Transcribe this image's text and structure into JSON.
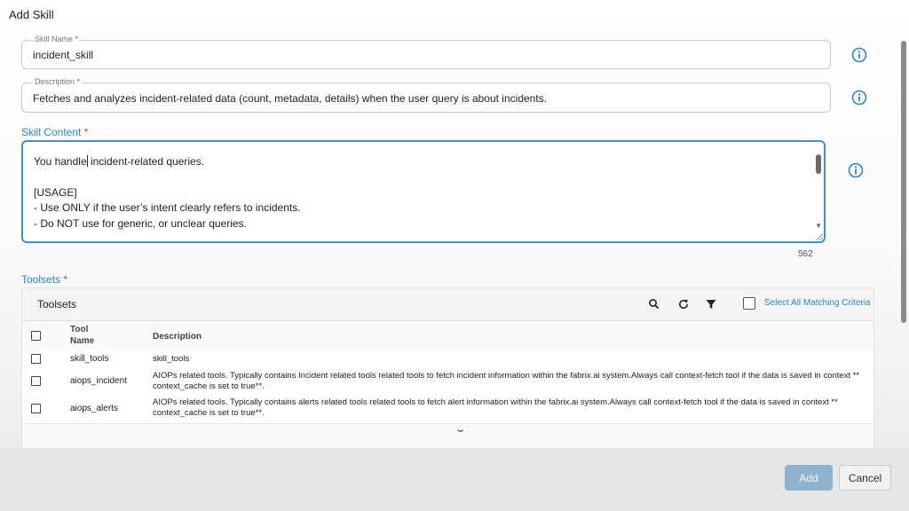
{
  "dialog": {
    "title": "Add Skill"
  },
  "skill_name": {
    "label": "Skill Name",
    "required_mark": "*",
    "value": "incident_skill"
  },
  "description": {
    "label": "Description",
    "required_mark": "*",
    "value": "Fetches and analyzes incident-related data (count, metadata, details) when the user query is about incidents."
  },
  "skill_content": {
    "label": "Skill Content",
    "required_mark": "*",
    "line1_before_caret": "You handle",
    "line1_after_caret": " incident-related queries.",
    "lines": [
      "[USAGE]",
      "- Use ONLY if the user’s intent clearly refers to incidents.",
      "- Do NOT use for generic, or unclear queries."
    ],
    "char_count": "562"
  },
  "toolsets": {
    "label": "Toolsets",
    "required_mark": "*",
    "panel_title": "Toolsets",
    "toolbar_icons": [
      "search-icon",
      "refresh-icon",
      "filter-icon"
    ],
    "select_all_label": "Select All Matching Criteria",
    "columns": {
      "tool_line1": "Tool",
      "tool_line2": "Name",
      "description": "Description"
    },
    "rows": [
      {
        "tool": "skill_tools",
        "description": "skill_tools"
      },
      {
        "tool": "aiops_incident",
        "description": "AIOPs related tools. Typically contains Incident related tools related tools to fetch incident information within the fabrix.ai system.Always call context-fetch tool if the data is saved in context ** context_cache is set to true**."
      },
      {
        "tool": "aiops_alerts",
        "description": "AIOPs related tools. Typically contains alerts related tools related tools to fetch alert information within the fabrix.ai system.Always call context-fetch tool if the data is saved in context ** context_cache is set to true**."
      }
    ]
  },
  "footer": {
    "add_label": "Add",
    "cancel_label": "Cancel"
  },
  "colors": {
    "accent": "#2a85c3",
    "required": "#dd3333",
    "add_button": "#8fb2cf"
  }
}
